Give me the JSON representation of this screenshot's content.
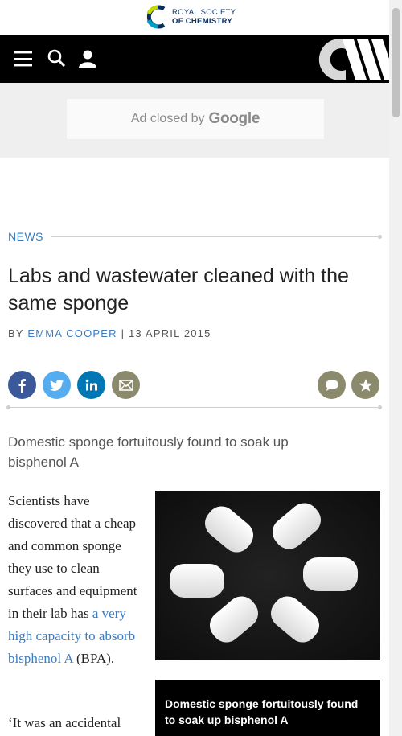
{
  "brand": {
    "line1": "ROYAL SOCIETY",
    "line2": "OF CHEMISTRY"
  },
  "nav": {
    "icons": [
      "menu-icon",
      "search-icon",
      "user-icon"
    ]
  },
  "ad": {
    "closed_text": "Ad closed by",
    "google_text": "Google"
  },
  "section": {
    "label": "NEWS"
  },
  "article": {
    "headline": "Labs and wastewater cleaned with the same sponge",
    "by_prefix": "BY",
    "author": "EMMA COOPER",
    "separator": "|",
    "date": "13 APRIL 2015",
    "standfirst": "Domestic sponge fortuitously found to soak up bisphenol A",
    "body_p1_start": "Scientists have discovered that a cheap and common sponge they use to clean surfaces and equipment in their lab has ",
    "body_p1_link": "a very high capacity to absorb bisphenol A",
    "body_p1_end": " (BPA).",
    "body_p2": "‘It was an accidental",
    "figure_caption": "Domestic sponge fortuitously found to soak up bisphenol A"
  },
  "share": {
    "facebook_color": "#3b5998",
    "twitter_color": "#55acee",
    "linkedin_color": "#0077b5",
    "email_color": "#8b8a6c",
    "comment_color": "#8b8a6c",
    "save_color": "#8b8a6c"
  }
}
